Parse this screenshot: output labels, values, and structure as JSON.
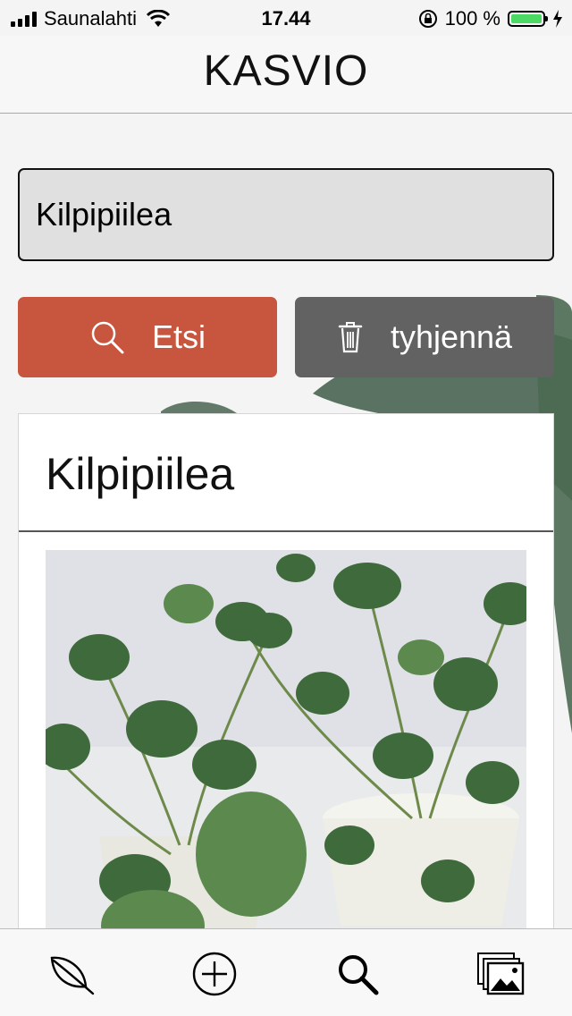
{
  "status_bar": {
    "carrier": "Saunalahti",
    "time": "17.44",
    "battery_percent": "100 %",
    "icons": [
      "signal-icon",
      "wifi-icon",
      "orientation-lock-icon",
      "battery-icon",
      "charging-icon"
    ]
  },
  "nav": {
    "title": "KASVIO"
  },
  "search": {
    "value": "Kilpipiilea",
    "search_button_label": "Etsi",
    "clear_button_label": "tyhjennä"
  },
  "result": {
    "title": "Kilpipiilea"
  },
  "tab_bar": {
    "items": [
      {
        "icon": "leaf-icon"
      },
      {
        "icon": "add-circle-icon"
      },
      {
        "icon": "search-icon"
      },
      {
        "icon": "gallery-icon"
      }
    ]
  },
  "colors": {
    "search_button": "#c8553d",
    "clear_button": "#636262",
    "input_bg": "#e0e0e0",
    "battery": "#4cd964"
  }
}
